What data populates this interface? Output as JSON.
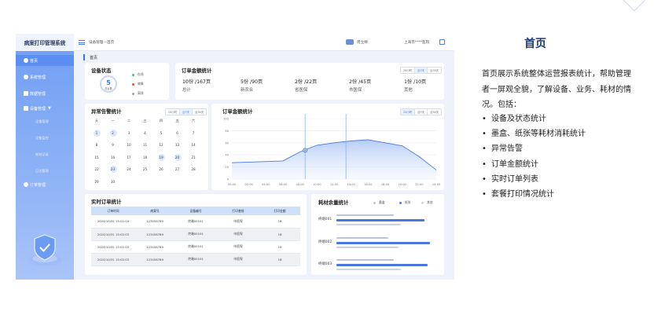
{
  "sidebar": {
    "title": "病案打印管理系统",
    "items": [
      {
        "label": "首页",
        "icon": "home-icon"
      },
      {
        "label": "系统管理",
        "icon": "gear-icon"
      },
      {
        "label": "数据管理",
        "icon": "database-icon"
      },
      {
        "label": "设备管理",
        "icon": "device-icon",
        "chevron": "▼"
      },
      {
        "label": "订单管理",
        "icon": "user-icon"
      }
    ],
    "subitems": [
      "设备管理",
      "设备监控",
      "耗材记录",
      "日志管理"
    ]
  },
  "topbar": {
    "breadcrumb": "设备管理—首页",
    "username": "周立婷",
    "hospital": "上海市****医院"
  },
  "page_tab": "首页",
  "device_status": {
    "title": "设备状态",
    "count": "5",
    "count_label": "总台数",
    "legend": [
      {
        "label": "在线",
        "color": "#4cc477"
      },
      {
        "label": "故障",
        "color": "#e84b4b"
      },
      {
        "label": "离线",
        "color": "#9aa3b1"
      }
    ]
  },
  "order_amount_summary": {
    "title": "订单金额统计",
    "periods": [
      "24小时",
      "近7天",
      "近30天"
    ],
    "active_period": 1,
    "stats": [
      {
        "value": "10份 /167页",
        "label": "总计"
      },
      {
        "value": "5份 /90页",
        "label": "新农合"
      },
      {
        "value": "2份 /22页",
        "label": "省医保"
      },
      {
        "value": "2份 /45页",
        "label": "市医保"
      },
      {
        "value": "1份 /10页",
        "label": "其他"
      }
    ]
  },
  "alarm_stats": {
    "title": "异常告警统计",
    "periods": [
      "24小时",
      "近7天",
      "近30天"
    ],
    "active_period": 1,
    "weekdays": [
      "天",
      "一",
      "二",
      "三",
      "四",
      "五",
      "六"
    ],
    "days": [
      [
        "",
        "",
        "",
        "",
        "",
        "",
        ""
      ],
      [
        "1",
        "2",
        "3",
        "4",
        "5",
        "6",
        "7"
      ],
      [
        "8",
        "9",
        "10",
        "11",
        "12",
        "13",
        "14"
      ],
      [
        "15",
        "16",
        "17",
        "18",
        "19",
        "20",
        "21"
      ],
      [
        "22",
        "23",
        "24",
        "25",
        "26",
        "27",
        "28"
      ],
      [
        "29",
        "30",
        "",
        "",
        "",
        "",
        ""
      ]
    ],
    "highlighted": [
      "1",
      "2",
      "19",
      "20",
      "23"
    ]
  },
  "chart_data": {
    "type": "area",
    "title": "订单金额统计",
    "x": [
      "00:00",
      "02:00",
      "04:00",
      "06:00",
      "08:00",
      "10:00",
      "12:00",
      "14:00",
      "16:00",
      "18:00",
      "20:00",
      "22:00",
      "24:00"
    ],
    "values": [
      27,
      28,
      29,
      30,
      45,
      56,
      60,
      63,
      65,
      60,
      55,
      37,
      15
    ],
    "yticks": [
      "0",
      "20",
      "40",
      "60",
      "80",
      "100"
    ],
    "ylim": [
      0,
      100
    ],
    "marker_x_index": 6.7,
    "periods": [
      "24小时",
      "近7天",
      "近30天"
    ],
    "active_period": 0,
    "color": "#4a78e0"
  },
  "realtime_orders": {
    "title": "实时订单统计",
    "columns": [
      "订单时间",
      "病案号",
      "设备编号",
      "打印套餐",
      "打印金额"
    ],
    "rows": [
      [
        "2024/10/31  15:02:03",
        "123456789",
        "终端00101",
        "市医保",
        "16"
      ],
      [
        "2024/10/31  15:02:03",
        "123456789",
        "终端00101",
        "市医保",
        "16"
      ],
      [
        "2024/10/31  15:02:03",
        "123456789",
        "终端00101",
        "市医保",
        "16"
      ],
      [
        "2024/10/31  15:02:03",
        "123456789",
        "终端00101",
        "市医保",
        "16"
      ]
    ]
  },
  "consumables": {
    "title": "耗材余量统计",
    "legend": [
      {
        "label": "墨盒",
        "color": "#b9c6dc"
      },
      {
        "label": "纸张",
        "color": "#4a78e0"
      },
      {
        "label": "其他",
        "color": "#c9d3e4"
      }
    ],
    "terminals": [
      {
        "name": "终端001",
        "ink": 0.55,
        "paper": 0.85,
        "other": 0.62
      },
      {
        "name": "终端002",
        "ink": 0.5,
        "paper": 0.9,
        "other": 0.6
      },
      {
        "name": "终端003",
        "ink": 0.55,
        "paper": 0.88,
        "other": 0.62
      }
    ]
  },
  "description": {
    "title": "首页",
    "intro": "首页展示系统整体运营报表统计，帮助管理者一屏观全貌，了解设备、业务、耗材的情况。包括：",
    "items": [
      "设备及状态统计",
      "墨盒、纸张等耗材消耗统计",
      "异常告警",
      "订单金额统计",
      "实时订单列表",
      "套餐打印情况统计"
    ]
  }
}
